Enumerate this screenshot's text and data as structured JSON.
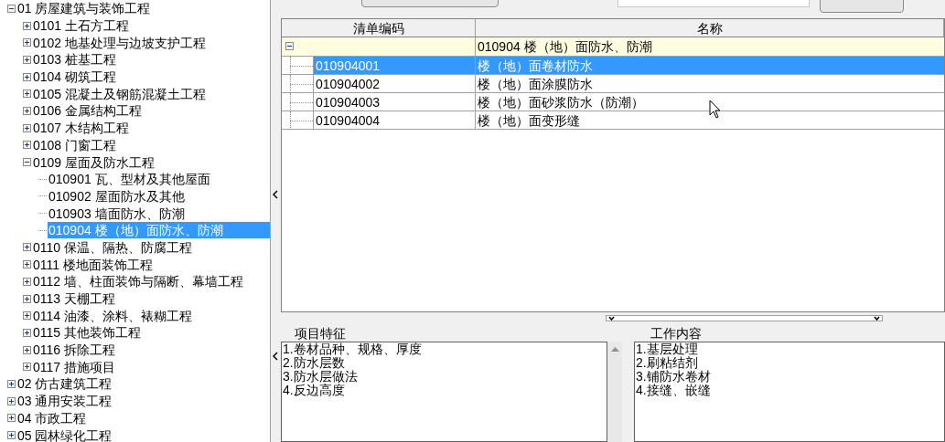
{
  "tree": [
    {
      "code": "01",
      "label": "房屋建筑与装饰工程",
      "expanded": true,
      "selected": false,
      "children": [
        {
          "code": "0101",
          "label": "土石方工程",
          "expanded": false,
          "selected": false
        },
        {
          "code": "0102",
          "label": "地基处理与边坡支护工程",
          "expanded": false,
          "selected": false
        },
        {
          "code": "0103",
          "label": "桩基工程",
          "expanded": false,
          "selected": false
        },
        {
          "code": "0104",
          "label": "砌筑工程",
          "expanded": false,
          "selected": false
        },
        {
          "code": "0105",
          "label": "混凝土及钢筋混凝土工程",
          "expanded": false,
          "selected": false
        },
        {
          "code": "0106",
          "label": "金属结构工程",
          "expanded": false,
          "selected": false
        },
        {
          "code": "0107",
          "label": "木结构工程",
          "expanded": false,
          "selected": false
        },
        {
          "code": "0108",
          "label": "门窗工程",
          "expanded": false,
          "selected": false
        },
        {
          "code": "0109",
          "label": "屋面及防水工程",
          "expanded": true,
          "selected": false,
          "children": [
            {
              "code": "010901",
              "label": "瓦、型材及其他屋面",
              "selected": false
            },
            {
              "code": "010902",
              "label": "屋面防水及其他",
              "selected": false
            },
            {
              "code": "010903",
              "label": "墙面防水、防潮",
              "selected": false
            },
            {
              "code": "010904",
              "label": "楼（地）面防水、防潮",
              "selected": true
            }
          ]
        },
        {
          "code": "0110",
          "label": "保温、隔热、防腐工程",
          "expanded": false,
          "selected": false
        },
        {
          "code": "0111",
          "label": "楼地面装饰工程",
          "expanded": false,
          "selected": false
        },
        {
          "code": "0112",
          "label": "墙、柱面装饰与隔断、幕墙工程",
          "expanded": false,
          "selected": false
        },
        {
          "code": "0113",
          "label": "天棚工程",
          "expanded": false,
          "selected": false
        },
        {
          "code": "0114",
          "label": "油漆、涂料、裱糊工程",
          "expanded": false,
          "selected": false
        },
        {
          "code": "0115",
          "label": "其他装饰工程",
          "expanded": false,
          "selected": false
        },
        {
          "code": "0116",
          "label": "拆除工程",
          "expanded": false,
          "selected": false
        },
        {
          "code": "0117",
          "label": "措施项目",
          "expanded": false,
          "selected": false
        }
      ]
    },
    {
      "code": "02",
      "label": "仿古建筑工程",
      "expanded": false,
      "selected": false
    },
    {
      "code": "03",
      "label": "通用安装工程",
      "expanded": false,
      "selected": false
    },
    {
      "code": "04",
      "label": "市政工程",
      "expanded": false,
      "selected": false
    },
    {
      "code": "05",
      "label": "园林绿化工程",
      "expanded": false,
      "selected": false
    }
  ],
  "grid": {
    "columns": [
      "清单编码",
      "名称"
    ],
    "group": {
      "expanded": true,
      "name": "010904 楼（地）面防水、防潮"
    },
    "rows": [
      {
        "code": "010904001",
        "name": "楼（地）面卷材防水",
        "selected": true
      },
      {
        "code": "010904002",
        "name": "楼（地）面涂膜防水",
        "selected": false
      },
      {
        "code": "010904003",
        "name": "楼（地）面砂浆防水（防潮）",
        "selected": false
      },
      {
        "code": "010904004",
        "name": "楼（地）面变形缝",
        "selected": false
      }
    ]
  },
  "features": {
    "title": "项目特征",
    "lines": [
      "1.卷材品种、规格、厚度",
      "2.防水层数",
      "3.防水层做法",
      "4.反边高度"
    ]
  },
  "work": {
    "title": "工作内容",
    "lines": [
      "1.基层处理",
      "2.刷粘结剂",
      "3.铺防水卷材",
      "4.接缝、嵌缝"
    ]
  }
}
